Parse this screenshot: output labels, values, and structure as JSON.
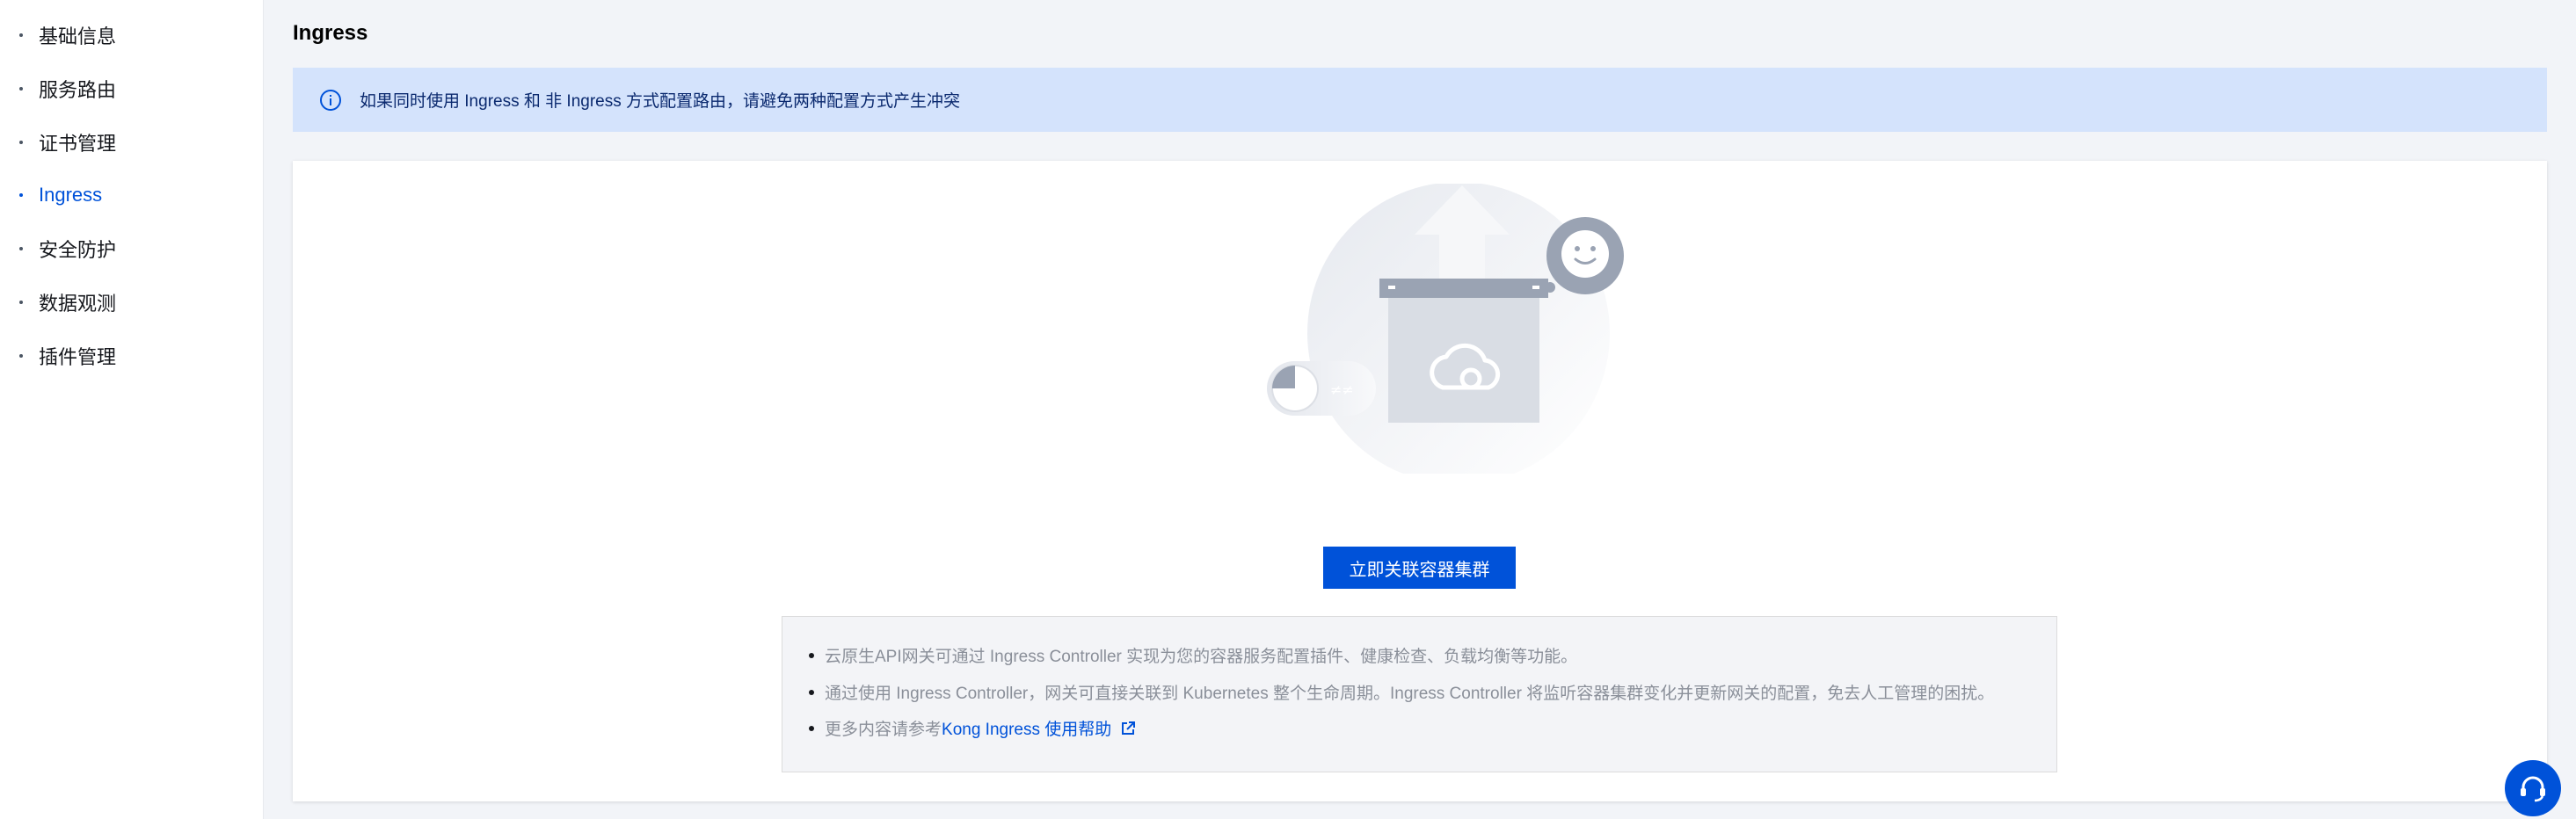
{
  "sidebar": {
    "items": [
      {
        "label": "基础信息",
        "active": false
      },
      {
        "label": "服务路由",
        "active": false
      },
      {
        "label": "证书管理",
        "active": false
      },
      {
        "label": "Ingress",
        "active": true
      },
      {
        "label": "安全防护",
        "active": false
      },
      {
        "label": "数据观测",
        "active": false
      },
      {
        "label": "插件管理",
        "active": false
      }
    ]
  },
  "main": {
    "title": "Ingress",
    "alert": {
      "icon": "info-circle-icon",
      "text": "如果同时使用 Ingress 和 非 Ingress 方式配置路由，请避免两种配置方式产生冲突"
    },
    "empty_state": {
      "illustration": "cloud-box-upload-illustration",
      "button_label": "立即关联容器集群",
      "tips": {
        "tip1": "云原生API网关可通过 Ingress Controller 实现为您的容器服务配置插件、健康检查、负载均衡等功能。",
        "tip2": "通过使用 Ingress Controller，网关可直接关联到 Kubernetes 整个生命周期。Ingress Controller 将监听容器集群变化并更新网关的配置，免去人工管理的困扰。",
        "tip3_prefix": "更多内容请参考",
        "tip3_link": "Kong Ingress 使用帮助"
      }
    }
  },
  "help_button": {
    "icon": "headset-icon"
  },
  "colors": {
    "accent": "#0052d9",
    "alert_bg": "#d4e3fc",
    "page_bg": "#f2f4f8"
  }
}
